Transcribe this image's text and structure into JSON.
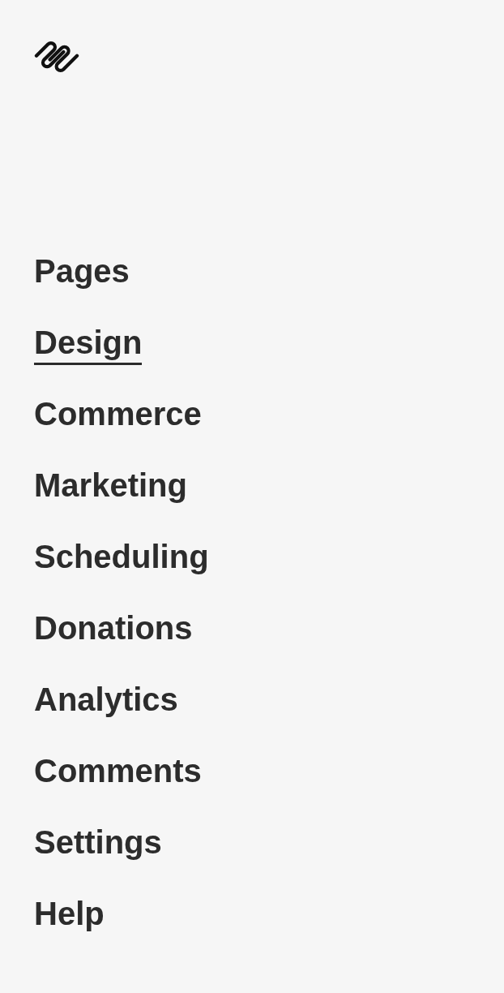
{
  "nav": {
    "items": [
      {
        "label": "Pages",
        "selected": false
      },
      {
        "label": "Design",
        "selected": true
      },
      {
        "label": "Commerce",
        "selected": false
      },
      {
        "label": "Marketing",
        "selected": false
      },
      {
        "label": "Scheduling",
        "selected": false
      },
      {
        "label": "Donations",
        "selected": false
      },
      {
        "label": "Analytics",
        "selected": false
      },
      {
        "label": "Comments",
        "selected": false
      },
      {
        "label": "Settings",
        "selected": false
      },
      {
        "label": "Help",
        "selected": false
      }
    ]
  }
}
